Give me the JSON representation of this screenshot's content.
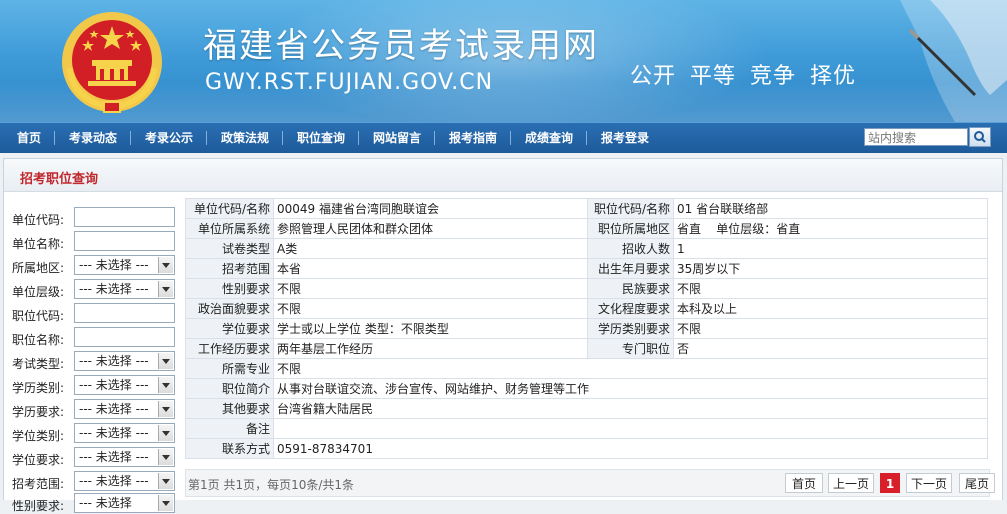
{
  "header": {
    "site_title": "福建省公务员考试录用网",
    "domain": "GWY.RST.FUJIAN.GOV.CN",
    "slogan": "公开  平等  竞争  择优"
  },
  "nav": {
    "items": [
      "首页",
      "考录动态",
      "考录公示",
      "政策法规",
      "职位查询",
      "网站留言",
      "报考指南",
      "成绩查询",
      "报考登录"
    ],
    "search_placeholder": "站内搜索"
  },
  "panel": {
    "title": "招考职位查询"
  },
  "filters": [
    {
      "label": "单位代码:",
      "type": "input",
      "value": ""
    },
    {
      "label": "单位名称:",
      "type": "input",
      "value": ""
    },
    {
      "label": "所属地区:",
      "type": "select",
      "value": "--- 未选择 ---"
    },
    {
      "label": "单位层级:",
      "type": "select",
      "value": "--- 未选择 ---"
    },
    {
      "label": "职位代码:",
      "type": "input",
      "value": ""
    },
    {
      "label": "职位名称:",
      "type": "input",
      "value": ""
    },
    {
      "label": "考试类型:",
      "type": "select",
      "value": "--- 未选择 ---"
    },
    {
      "label": "学历类别:",
      "type": "select",
      "value": "--- 未选择 ---"
    },
    {
      "label": "学历要求:",
      "type": "select",
      "value": "--- 未选择 ---"
    },
    {
      "label": "学位类别:",
      "type": "select",
      "value": "--- 未选择 ---"
    },
    {
      "label": "学位要求:",
      "type": "select",
      "value": "--- 未选择 ---"
    },
    {
      "label": "招考范围:",
      "type": "select",
      "value": "--- 未选择 ---"
    },
    {
      "label": "性别要求:",
      "type": "select",
      "value": "--- 未选择"
    }
  ],
  "detail": {
    "rows": [
      {
        "l1": "单位代码/名称",
        "v1": "00049 福建省台湾同胞联谊会",
        "l2": "职位代码/名称",
        "v2": "01 省台联联络部"
      },
      {
        "l1": "单位所属系统",
        "v1": "参照管理人民团体和群众团体",
        "l2": "职位所属地区",
        "v2": "省直    单位层级：省直"
      },
      {
        "l1": "试卷类型",
        "v1": "A类",
        "l2": "招收人数",
        "v2": "1"
      },
      {
        "l1": "招考范围",
        "v1": "本省",
        "l2": "出生年月要求",
        "v2": "35周岁以下"
      },
      {
        "l1": "性别要求",
        "v1": "不限",
        "l2": "民族要求",
        "v2": "不限"
      },
      {
        "l1": "政治面貌要求",
        "v1": "不限",
        "l2": "文化程度要求",
        "v2": "本科及以上"
      },
      {
        "l1": "学位要求",
        "v1": "学士或以上学位 类型：不限类型",
        "l2": "学历类别要求",
        "v2": "不限"
      },
      {
        "l1": "工作经历要求",
        "v1": "两年基层工作经历",
        "l2": "专门职位",
        "v2": "否"
      }
    ],
    "wide_rows": [
      {
        "label": "所需专业",
        "value": "不限"
      },
      {
        "label": "职位简介",
        "value": "从事对台联谊交流、涉台宣传、网站维护、财务管理等工作"
      },
      {
        "label": "其他要求",
        "value": "台湾省籍大陆居民"
      },
      {
        "label": "备注",
        "value": ""
      },
      {
        "label": "联系方式",
        "value": "0591-87834701"
      }
    ]
  },
  "pager": {
    "info": "第1页 共1页，每页10条/共1条",
    "first": "首页",
    "prev": "上一页",
    "current": "1",
    "next": "下一页",
    "last": "尾页"
  }
}
